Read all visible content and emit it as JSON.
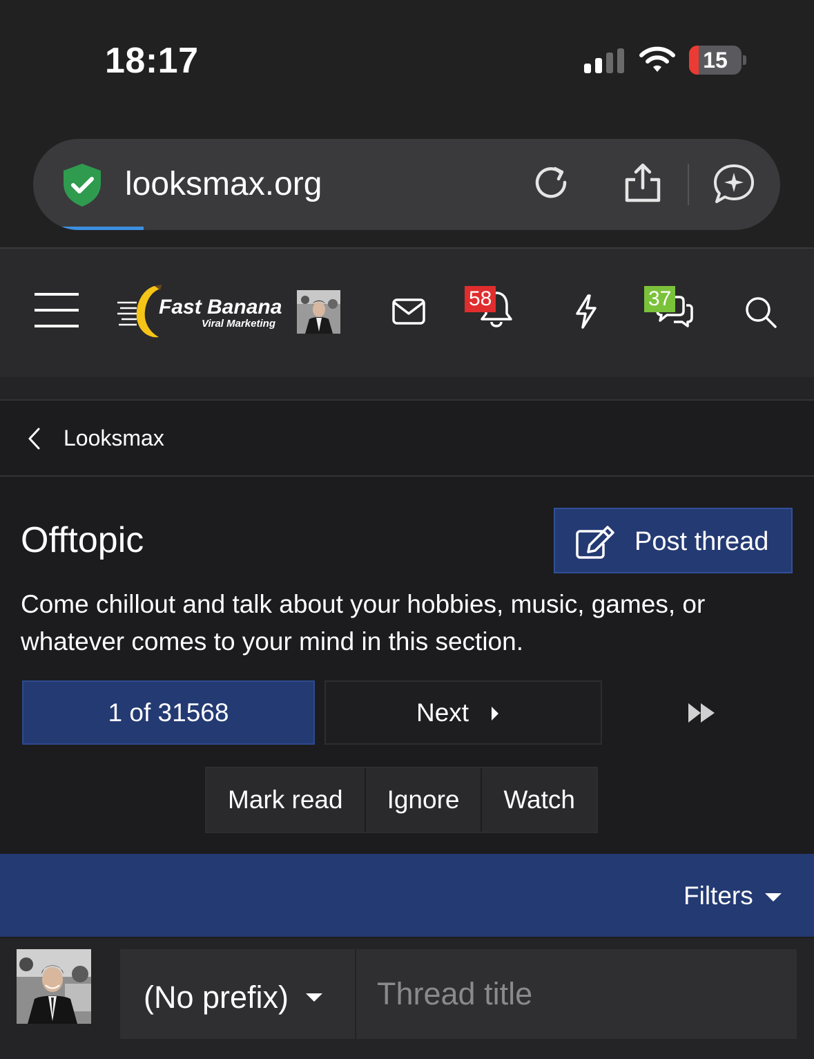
{
  "status_bar": {
    "time": "18:17",
    "battery": "15"
  },
  "browser": {
    "url": "looksmax.org"
  },
  "nav": {
    "logo_title": "Fast Banana",
    "logo_subtitle": "Viral Marketing",
    "alerts_count": "58",
    "conversations_count": "37",
    "colors": {
      "alerts_badge": "#e02d2d",
      "conversations_badge": "#7bc23b"
    }
  },
  "breadcrumb": {
    "label": "Looksmax"
  },
  "forum": {
    "title": "Offtopic",
    "post_thread_label": "Post thread",
    "description": "Come chillout and talk about your hobbies, music, games, or whatever comes to your mind in this section."
  },
  "pagination": {
    "current": "1 of 31568",
    "next_label": "Next"
  },
  "actions": {
    "mark_read": "Mark read",
    "ignore": "Ignore",
    "watch": "Watch"
  },
  "filters": {
    "label": "Filters"
  },
  "quick_thread": {
    "prefix": "(No prefix)",
    "title_placeholder": "Thread title"
  },
  "theme": {
    "accent": "#243a73",
    "background": "#1c1c1e"
  }
}
